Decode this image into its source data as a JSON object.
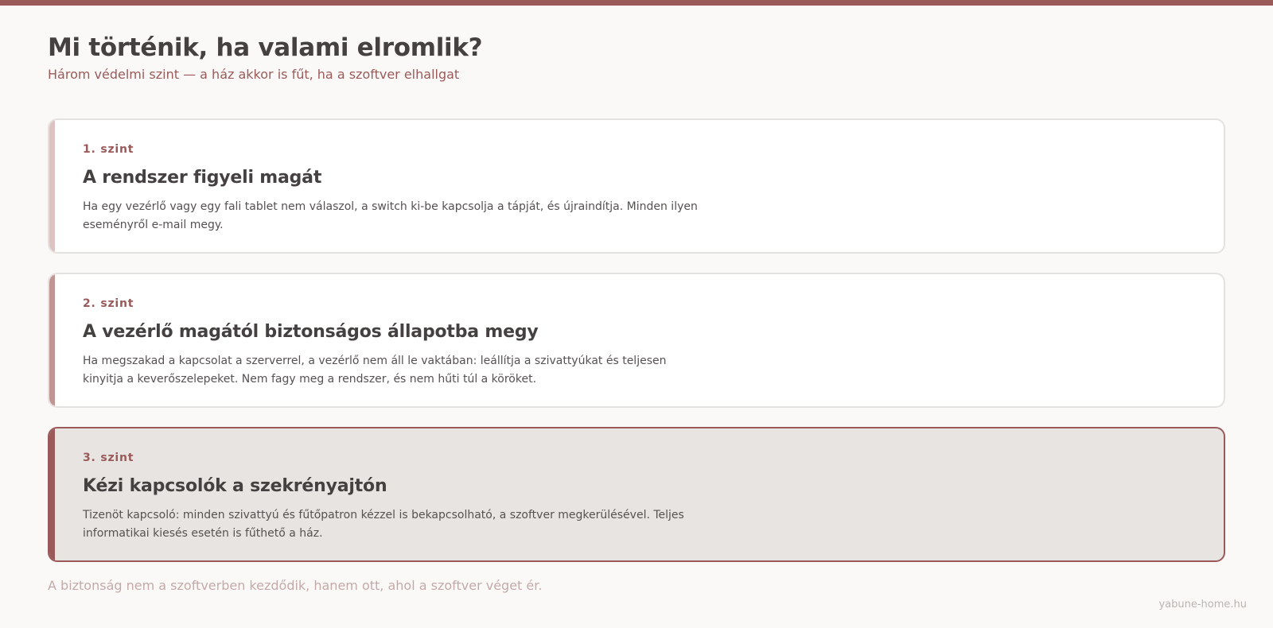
{
  "header": {
    "title": "Mi történik, ha valami elromlik?",
    "subtitle": "Három védelmi szint — a ház akkor is fűt, ha a szoftver elhallgat"
  },
  "levels": [
    {
      "label": "1. szint",
      "title": "A rendszer figyeli magát",
      "description": "Ha egy vezérlő vagy egy fali tablet nem válaszol, a switch ki-be kapcsolja a tápját, és újraindítja. Minden ilyen eseményről e-mail megy."
    },
    {
      "label": "2. szint",
      "title": "A vezérlő magától biztonságos állapotba megy",
      "description": "Ha megszakad a kapcsolat a szerverrel, a vezérlő nem áll le vaktában: leállítja a szivattyúkat és teljesen kinyitja a keverőszelepeket. Nem fagy meg a rendszer, és nem hűti túl a köröket."
    },
    {
      "label": "3. szint",
      "title": "Kézi kapcsolók a szekrényajtón",
      "description": "Tizenöt kapcsoló: minden szivattyú és fűtőpatron kézzel is bekapcsolható, a szoftver megkerülésével. Teljes informatikai kiesés esetén is fűthető a ház."
    }
  ],
  "footer": {
    "note": "A biztonság nem a szoftverben kezdődik, hanem ott, ahol a szoftver véget ér.",
    "credit": "yabune-home.hu"
  },
  "colors": {
    "accent": "#9a5a5a",
    "level1_accent": "#dcc3c1",
    "level2_accent": "#c19593",
    "level3_accent": "#9a5a5a",
    "background": "#fbf9f8"
  }
}
